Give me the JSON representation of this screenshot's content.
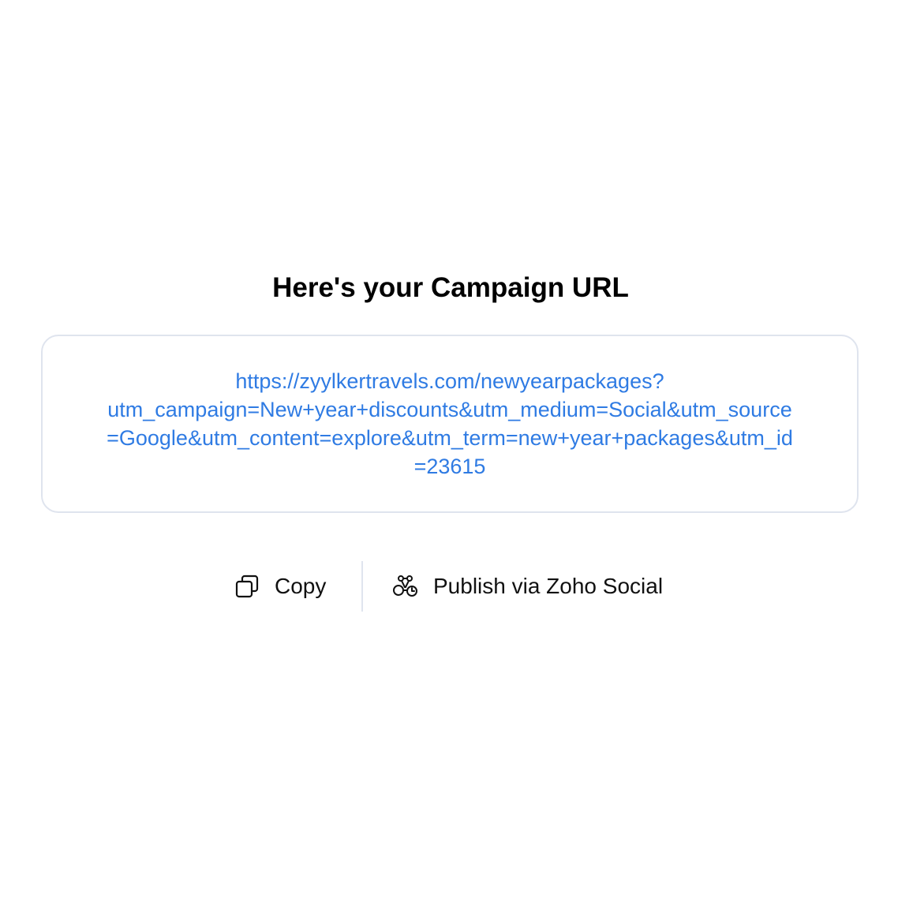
{
  "page": {
    "title": "Here's your Campaign URL"
  },
  "campaign_url": {
    "lines": [
      "https://zyylkertravels.com/newyearpackages?",
      "utm_campaign=New+year+discounts&utm_medium=Social&utm_source",
      "=Google&utm_content=explore&utm_term=new+year+packages&utm_id",
      "=23615"
    ],
    "color": "#2f7be3"
  },
  "actions": {
    "copy": {
      "label": "Copy",
      "icon": "copy-icon"
    },
    "publish": {
      "label": "Publish via Zoho Social",
      "icon": "zoho-social-icon"
    }
  }
}
